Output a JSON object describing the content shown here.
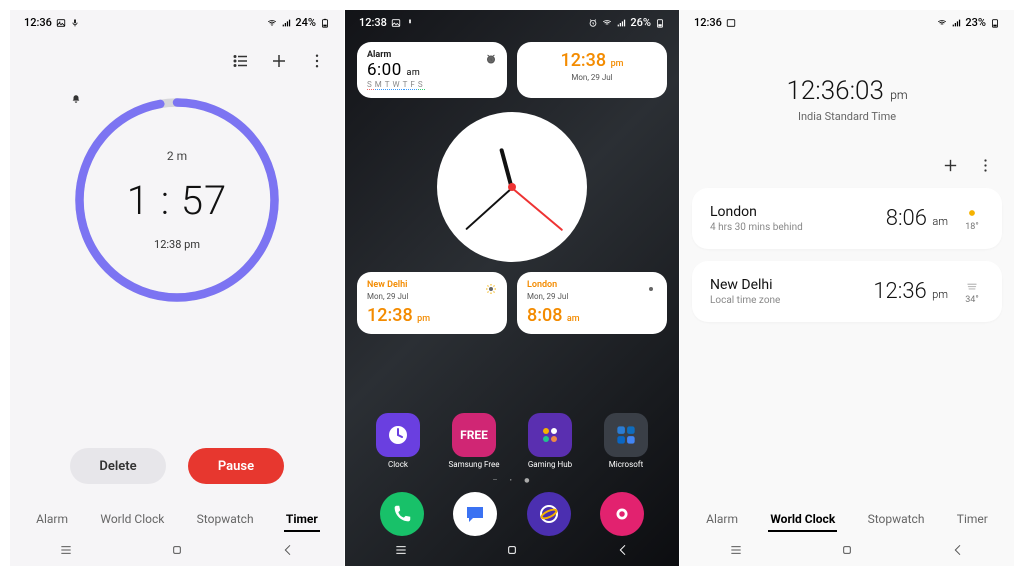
{
  "phone1": {
    "status": {
      "time": "12:36",
      "battery": "24%"
    },
    "timer": {
      "duration": "2 m",
      "remaining": "1 : 57",
      "end_label": "12:38 pm",
      "progress": 0.97
    },
    "buttons": {
      "delete": "Delete",
      "pause": "Pause"
    },
    "tabs": [
      "Alarm",
      "World Clock",
      "Stopwatch",
      "Timer"
    ],
    "active_tab": "Timer",
    "colors": {
      "ring": "#7c74f2",
      "ring_bg": "#d6d6da"
    }
  },
  "phone2": {
    "status": {
      "time": "12:38",
      "battery": "26%"
    },
    "widgets": {
      "alarm": {
        "label": "Alarm",
        "time": "6:00",
        "ampm": "am",
        "days": [
          "S",
          "M",
          "T",
          "W",
          "T",
          "F",
          "S"
        ]
      },
      "digital": {
        "time": "12:38",
        "ampm": "pm",
        "date": "Mon, 29 Jul"
      },
      "wc1": {
        "city": "New Delhi",
        "date": "Mon, 29 Jul",
        "time": "12:38",
        "ampm": "pm"
      },
      "wc2": {
        "city": "London",
        "date": "Mon, 29 Jul",
        "time": "8:08",
        "ampm": "am"
      }
    },
    "analog": {
      "hour_angle": -105,
      "minute_angle": 138,
      "second_angle": 40
    },
    "apps_row": [
      {
        "name": "Clock",
        "bg": "#6a3fe0",
        "glyph": "clock"
      },
      {
        "name": "Samsung Free",
        "bg": "#d02674",
        "glyph": "free"
      },
      {
        "name": "Gaming Hub",
        "bg": "#5a2fb0",
        "glyph": "gaming"
      },
      {
        "name": "Microsoft",
        "bg": "#3a3f47",
        "glyph": "grid"
      }
    ],
    "dock": [
      {
        "name": "Phone",
        "bg": "#18c169",
        "glyph": "phone"
      },
      {
        "name": "Messages",
        "bg": "#ffffff",
        "glyph": "chat"
      },
      {
        "name": "Internet",
        "bg": "#4b2fb0",
        "glyph": "planet"
      },
      {
        "name": "Camera",
        "bg": "#e2226f",
        "glyph": "camera"
      }
    ]
  },
  "phone3": {
    "status": {
      "time": "12:36",
      "battery": "23%"
    },
    "header": {
      "clock": "12:36:03",
      "ampm": "pm",
      "tz": "India Standard Time"
    },
    "cities": [
      {
        "name": "London",
        "sub": "4 hrs 30 mins behind",
        "time": "8:06",
        "ampm": "am",
        "temp": "18°",
        "icon": "sun"
      },
      {
        "name": "New Delhi",
        "sub": "Local time zone",
        "time": "12:36",
        "ampm": "pm",
        "temp": "34°",
        "icon": "fog"
      }
    ],
    "tabs": [
      "Alarm",
      "World Clock",
      "Stopwatch",
      "Timer"
    ],
    "active_tab": "World Clock"
  }
}
